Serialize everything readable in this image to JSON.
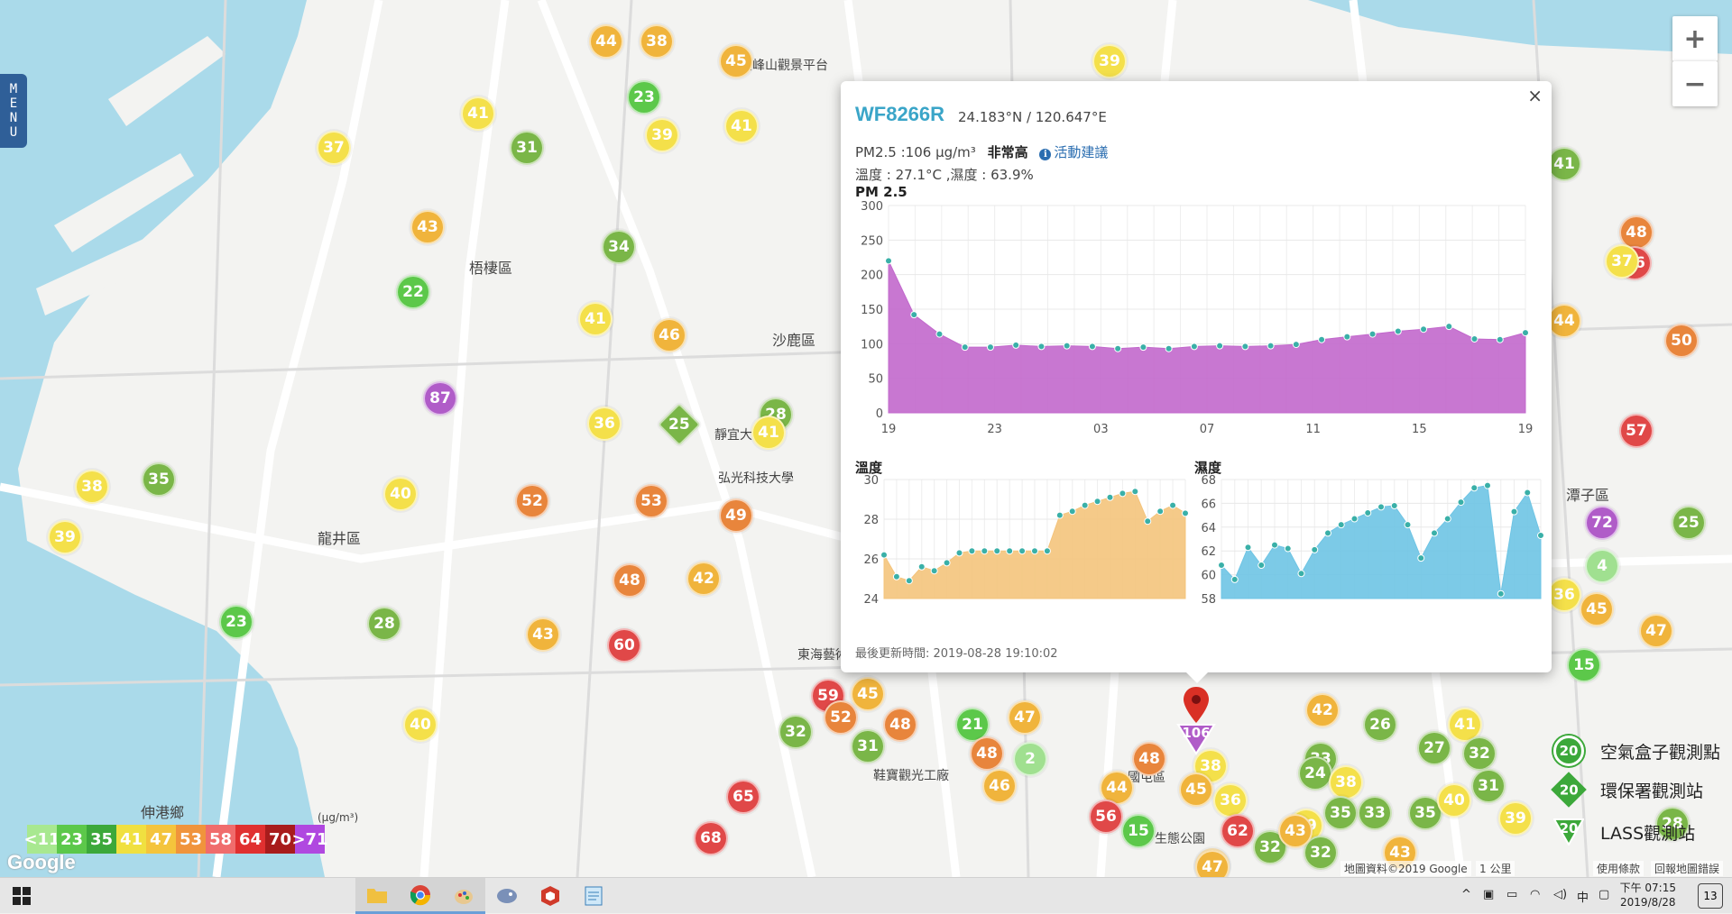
{
  "map": {
    "menu_label": "MENU",
    "zoom_in": "+",
    "zoom_out": "−",
    "places": [
      {
        "name": "梧棲區"
      },
      {
        "name": "沙鹿區"
      },
      {
        "name": "龍井區"
      },
      {
        "name": "靜宜大"
      },
      {
        "name": "弘光科技大學"
      },
      {
        "name": "東海藝術"
      },
      {
        "name": "鰲峰山觀景平台"
      },
      {
        "name": "潭子區"
      },
      {
        "name": "伸港鄉"
      },
      {
        "name": "鞋寶觀光工廠"
      },
      {
        "name": "生態公園"
      },
      {
        "name": "國屯區"
      }
    ],
    "colors": {
      "green": "#7ab648",
      "lime": "#5cc84a",
      "yellow": "#f4e04a",
      "orange": "#f0b43c",
      "dorange": "#e8853c",
      "red": "#e04848",
      "purple": "#b05cc8",
      "lgreen": "#a0e090",
      "water": "#aadaea"
    },
    "markers": [
      {
        "v": "44",
        "c": "orange"
      },
      {
        "v": "38",
        "c": "orange"
      },
      {
        "v": "45",
        "c": "orange"
      },
      {
        "v": "23",
        "c": "lime"
      },
      {
        "v": "41",
        "c": "yellow"
      },
      {
        "v": "39",
        "c": "yellow"
      },
      {
        "v": "41",
        "c": "yellow"
      },
      {
        "v": "37",
        "c": "yellow"
      },
      {
        "v": "31",
        "c": "green"
      },
      {
        "v": "43",
        "c": "orange"
      },
      {
        "v": "34",
        "c": "green"
      },
      {
        "v": "22",
        "c": "lime"
      },
      {
        "v": "41",
        "c": "yellow"
      },
      {
        "v": "46",
        "c": "orange"
      },
      {
        "v": "87",
        "c": "purple"
      },
      {
        "v": "36",
        "c": "yellow"
      },
      {
        "v": "28",
        "c": "green"
      },
      {
        "v": "41",
        "c": "yellow"
      },
      {
        "v": "38",
        "c": "yellow"
      },
      {
        "v": "35",
        "c": "green"
      },
      {
        "v": "39",
        "c": "yellow"
      },
      {
        "v": "40",
        "c": "yellow"
      },
      {
        "v": "52",
        "c": "dorange"
      },
      {
        "v": "53",
        "c": "dorange"
      },
      {
        "v": "49",
        "c": "dorange"
      },
      {
        "v": "48",
        "c": "dorange"
      },
      {
        "v": "42",
        "c": "orange"
      },
      {
        "v": "23",
        "c": "lime"
      },
      {
        "v": "28",
        "c": "green"
      },
      {
        "v": "43",
        "c": "orange"
      },
      {
        "v": "60",
        "c": "red"
      },
      {
        "v": "40",
        "c": "yellow"
      },
      {
        "v": "59",
        "c": "red"
      },
      {
        "v": "45",
        "c": "orange"
      },
      {
        "v": "52",
        "c": "dorange"
      },
      {
        "v": "32",
        "c": "green"
      },
      {
        "v": "48",
        "c": "dorange"
      },
      {
        "v": "31",
        "c": "green"
      },
      {
        "v": "21",
        "c": "lime"
      },
      {
        "v": "47",
        "c": "orange"
      },
      {
        "v": "48",
        "c": "dorange"
      },
      {
        "v": "46",
        "c": "orange"
      },
      {
        "v": "2",
        "c": "lgreen"
      },
      {
        "v": "65",
        "c": "red"
      },
      {
        "v": "68",
        "c": "red"
      },
      {
        "v": "39",
        "c": "yellow"
      },
      {
        "v": "41",
        "c": "green"
      },
      {
        "v": "48",
        "c": "dorange"
      },
      {
        "v": "56",
        "c": "red"
      },
      {
        "v": "44",
        "c": "orange"
      },
      {
        "v": "37",
        "c": "yellow"
      },
      {
        "v": "44",
        "c": "orange"
      },
      {
        "v": "50",
        "c": "dorange"
      },
      {
        "v": "57",
        "c": "red"
      },
      {
        "v": "72",
        "c": "purple"
      },
      {
        "v": "4",
        "c": "lgreen"
      },
      {
        "v": "25",
        "c": "green"
      },
      {
        "v": "36",
        "c": "yellow"
      },
      {
        "v": "45",
        "c": "orange"
      },
      {
        "v": "47",
        "c": "orange"
      },
      {
        "v": "15",
        "c": "lime"
      },
      {
        "v": "42",
        "c": "orange"
      },
      {
        "v": "26",
        "c": "green"
      },
      {
        "v": "41",
        "c": "yellow"
      },
      {
        "v": "27",
        "c": "green"
      },
      {
        "v": "32",
        "c": "green"
      },
      {
        "v": "33",
        "c": "green"
      },
      {
        "v": "24",
        "c": "green"
      },
      {
        "v": "38",
        "c": "yellow"
      },
      {
        "v": "35",
        "c": "green"
      },
      {
        "v": "33",
        "c": "green"
      },
      {
        "v": "35",
        "c": "green"
      },
      {
        "v": "40",
        "c": "yellow"
      },
      {
        "v": "39",
        "c": "yellow"
      },
      {
        "v": "32",
        "c": "green"
      },
      {
        "v": "43",
        "c": "orange"
      },
      {
        "v": "47",
        "c": "orange"
      },
      {
        "v": "38",
        "c": "yellow"
      },
      {
        "v": "48",
        "c": "dorange"
      },
      {
        "v": "45",
        "c": "orange"
      },
      {
        "v": "36",
        "c": "yellow"
      },
      {
        "v": "44",
        "c": "orange"
      },
      {
        "v": "56",
        "c": "red"
      },
      {
        "v": "15",
        "c": "lime"
      },
      {
        "v": "62",
        "c": "red"
      },
      {
        "v": "32",
        "c": "green"
      },
      {
        "v": "47",
        "c": "orange"
      },
      {
        "v": "43",
        "c": "orange"
      },
      {
        "v": "31",
        "c": "green"
      },
      {
        "v": "39",
        "c": "yellow"
      },
      {
        "v": "28",
        "c": "green"
      }
    ],
    "selected_marker": {
      "v": "106",
      "c": "purple"
    },
    "diamond_marker": {
      "v": "25",
      "c": "green"
    }
  },
  "popup": {
    "station_id": "WF8266R",
    "coords": "24.183°N / 120.647°E",
    "pm_text": "PM2.5 :106 μg/m³",
    "level": "非常高",
    "advice": "活動建議",
    "info_icon": "i",
    "temp_humidity": "溫度 : 27.1°C ,濕度 : 63.9%",
    "pm_title": "PM 2.5",
    "temp_title": "溫度",
    "humid_title": "濕度",
    "updated": "最後更新時間: 2019-08-28 19:10:02",
    "close": "×"
  },
  "chart_data": [
    {
      "type": "area",
      "title": "PM 2.5",
      "x_ticks": [
        "19",
        "23",
        "03",
        "07",
        "11",
        "15",
        "19"
      ],
      "ylim": [
        0,
        300
      ],
      "y_ticks": [
        0,
        50,
        100,
        150,
        200,
        250,
        300
      ],
      "color": "#c268cc",
      "values": [
        220,
        142,
        114,
        95,
        95,
        98,
        96,
        97,
        96,
        93,
        95,
        93,
        96,
        97,
        96,
        97,
        99,
        106,
        110,
        114,
        118,
        121,
        125,
        107,
        106,
        116
      ]
    },
    {
      "type": "area",
      "title": "溫度",
      "ylim": [
        24,
        30
      ],
      "y_ticks": [
        24,
        26,
        28,
        30
      ],
      "color": "#f4c47c",
      "values": [
        26.2,
        25.1,
        24.9,
        25.6,
        25.4,
        25.8,
        26.3,
        26.4,
        26.4,
        26.4,
        26.4,
        26.4,
        26.4,
        26.4,
        28.2,
        28.4,
        28.7,
        28.9,
        29.1,
        29.3,
        29.4,
        27.9,
        28.4,
        28.7,
        28.3
      ]
    },
    {
      "type": "area",
      "title": "濕度",
      "ylim": [
        58,
        68
      ],
      "y_ticks": [
        58,
        60,
        62,
        64,
        66,
        68
      ],
      "color": "#6ec4e4",
      "values": [
        60.8,
        59.6,
        62.3,
        60.8,
        62.5,
        62.2,
        60.1,
        62.1,
        63.5,
        64.2,
        64.7,
        65.2,
        65.7,
        65.8,
        64.2,
        61.4,
        63.5,
        64.7,
        66.1,
        67.3,
        67.5,
        58.4,
        65.3,
        66.9,
        63.3
      ]
    }
  ],
  "legend": {
    "unit": "(μg/m³)",
    "cells": [
      {
        "label": "<11",
        "color": "#a8e890"
      },
      {
        "label": "23",
        "color": "#5cc84a"
      },
      {
        "label": "35",
        "color": "#3ca83a"
      },
      {
        "label": "41",
        "color": "#f0e040"
      },
      {
        "label": "47",
        "color": "#f4c43c"
      },
      {
        "label": "53",
        "color": "#f0943c"
      },
      {
        "label": "58",
        "color": "#f06c6c"
      },
      {
        "label": "64",
        "color": "#e03030"
      },
      {
        "label": "70",
        "color": "#a81c1c"
      },
      {
        "label": ">71",
        "color": "#b048e0"
      }
    ]
  },
  "map_key": [
    {
      "label": "空氣盒子觀測點",
      "value": "20"
    },
    {
      "label": "環保署觀測站",
      "value": "20"
    },
    {
      "label": "LASS觀測站",
      "value": "20"
    }
  ],
  "google_logo": "Google",
  "attribution": {
    "data": "地圖資料©2019 Google",
    "scale": "1 公里",
    "terms": "使用條款",
    "report": "回報地圖錯誤"
  },
  "taskbar": {
    "apps": [
      {
        "name": "file-explorer"
      },
      {
        "name": "chrome"
      },
      {
        "name": "paint"
      },
      {
        "name": "app-bird"
      },
      {
        "name": "sketchup"
      },
      {
        "name": "notepad"
      }
    ],
    "ime": "中",
    "time": "下午 07:15",
    "date": "2019/8/28",
    "notif_count": "13"
  }
}
